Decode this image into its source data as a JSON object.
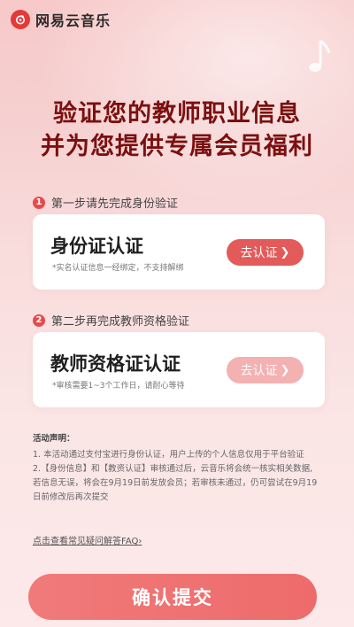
{
  "brand": {
    "name": "网易云音乐",
    "icon": "netease-music-logo"
  },
  "headline": {
    "line1": "验证您的教师职业信息",
    "line2": "并为您提供专属会员福利"
  },
  "steps": [
    {
      "number": "1",
      "title": "第一步请先完成身份验证",
      "card_title": "身份证认证",
      "card_sub": "*实名认证信息一经绑定，不支持解绑",
      "button": "去认证",
      "enabled": true
    },
    {
      "number": "2",
      "title": "第二步再完成教师资格验证",
      "card_title": "教师资格证认证",
      "card_sub": "*审核需要1~3个工作日，请耐心等待",
      "button": "去认证",
      "enabled": false
    }
  ],
  "notes": {
    "title": "活动声明：",
    "lines": [
      "1. 本活动通过支付宝进行身份认证，用户上传的个人信息仅用于平台验证",
      "2.【身份信息】和【教资认证】审核通过后，云音乐将会统一核实相关数据,",
      "若信息无误，将会在9月19日前发放会员；若审核未通过，仍可尝试在9月19",
      "日前修改后再次提交"
    ]
  },
  "faq": {
    "label": "点击查看常见疑问解答FAQ",
    "chevron": "›"
  },
  "submit": {
    "label": "确认提交"
  },
  "colors": {
    "accent": "#e35a5a",
    "headline": "#7a1010",
    "disabled": "#f3b1b1"
  }
}
